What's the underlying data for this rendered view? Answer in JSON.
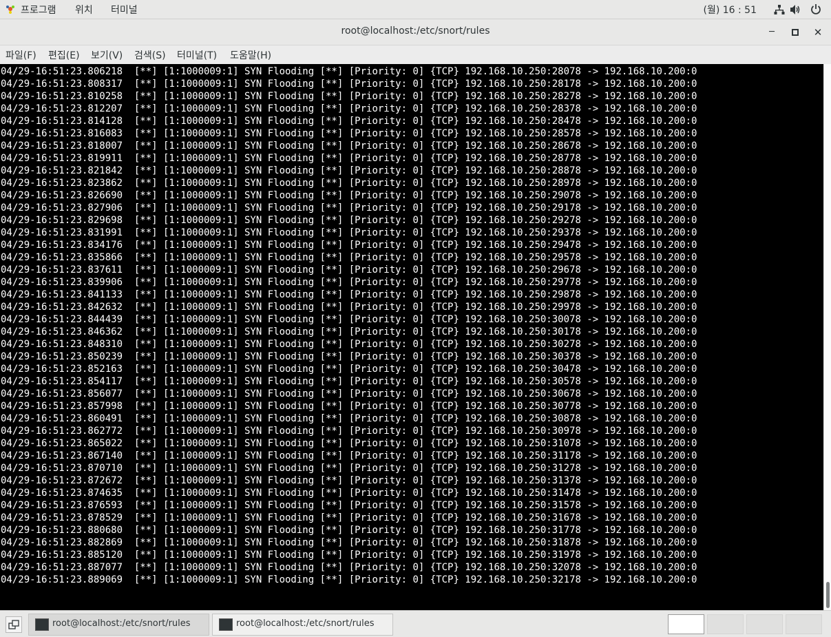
{
  "top_bar": {
    "menus": [
      "프로그램",
      "위치",
      "터미널"
    ],
    "clock": "(월) 16 : 51"
  },
  "window": {
    "title": "root@localhost:/etc/snort/rules"
  },
  "menu_bar": [
    "파일(F)",
    "편집(E)",
    "보기(V)",
    "검색(S)",
    "터미널(T)",
    "도움말(H)"
  ],
  "log": {
    "date_prefix": "04/29-16:51:23.",
    "alert": "[**] [1:1000009:1] SYN Flooding [**] [Priority: 0] {TCP}",
    "src_ip": "192.168.10.250",
    "dst": "192.168.10.200:0",
    "entries": [
      [
        "806218",
        "28078"
      ],
      [
        "808317",
        "28178"
      ],
      [
        "810258",
        "28278"
      ],
      [
        "812207",
        "28378"
      ],
      [
        "814128",
        "28478"
      ],
      [
        "816083",
        "28578"
      ],
      [
        "818007",
        "28678"
      ],
      [
        "819911",
        "28778"
      ],
      [
        "821842",
        "28878"
      ],
      [
        "823862",
        "28978"
      ],
      [
        "826690",
        "29078"
      ],
      [
        "827906",
        "29178"
      ],
      [
        "829698",
        "29278"
      ],
      [
        "831991",
        "29378"
      ],
      [
        "834176",
        "29478"
      ],
      [
        "835866",
        "29578"
      ],
      [
        "837611",
        "29678"
      ],
      [
        "839906",
        "29778"
      ],
      [
        "841133",
        "29878"
      ],
      [
        "842632",
        "29978"
      ],
      [
        "844439",
        "30078"
      ],
      [
        "846362",
        "30178"
      ],
      [
        "848310",
        "30278"
      ],
      [
        "850239",
        "30378"
      ],
      [
        "852163",
        "30478"
      ],
      [
        "854117",
        "30578"
      ],
      [
        "856077",
        "30678"
      ],
      [
        "857998",
        "30778"
      ],
      [
        "860491",
        "30878"
      ],
      [
        "862772",
        "30978"
      ],
      [
        "865022",
        "31078"
      ],
      [
        "867140",
        "31178"
      ],
      [
        "870710",
        "31278"
      ],
      [
        "872672",
        "31378"
      ],
      [
        "874635",
        "31478"
      ],
      [
        "876593",
        "31578"
      ],
      [
        "878529",
        "31678"
      ],
      [
        "880680",
        "31778"
      ],
      [
        "882869",
        "31878"
      ],
      [
        "885120",
        "31978"
      ],
      [
        "887077",
        "32078"
      ],
      [
        "889069",
        "32178"
      ]
    ]
  },
  "taskbar": {
    "tasks": [
      "root@localhost:/etc/snort/rules",
      "root@localhost:/etc/snort/rules"
    ]
  }
}
